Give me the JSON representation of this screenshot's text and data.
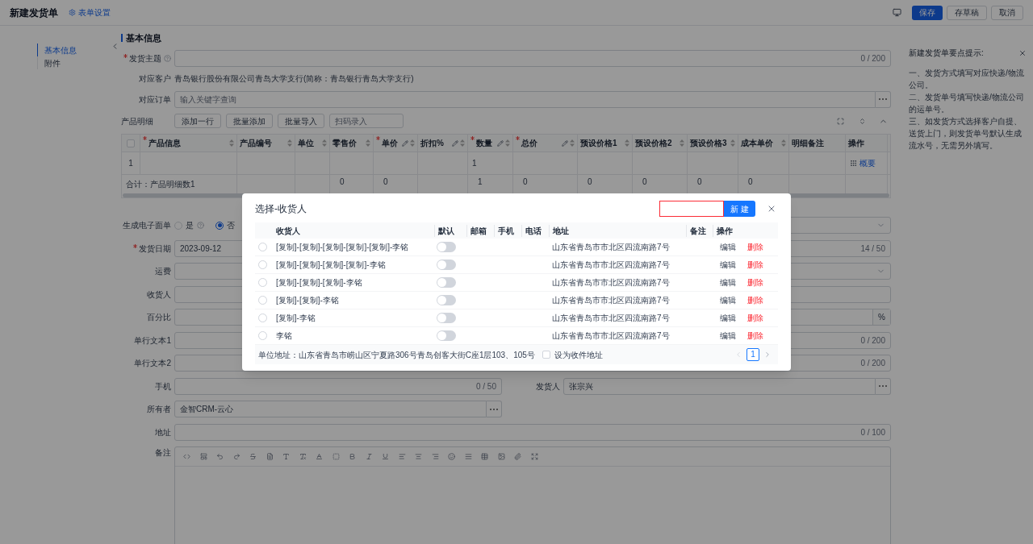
{
  "header": {
    "title": "新建发货单",
    "settings_link": "表单设置",
    "buttons": [
      {
        "label": "保存",
        "kind": "primary"
      },
      {
        "label": "存草稿",
        "kind": "default"
      },
      {
        "label": "取消",
        "kind": "default"
      }
    ]
  },
  "nav": {
    "items": [
      {
        "label": "基本信息",
        "selected": true
      },
      {
        "label": "附件",
        "selected": false
      }
    ]
  },
  "section_title": "基本信息",
  "form_top": [
    {
      "fields": [
        {
          "label": "发货主题",
          "required": true,
          "help": true,
          "kind": "input",
          "counter": "0 / 200"
        }
      ]
    },
    {
      "fields": [
        {
          "label": "对应客户",
          "kind": "text",
          "value": "青岛银行股份有限公司青岛大学支行(简称：青岛银行青岛大学支行)"
        }
      ]
    },
    {
      "fields": [
        {
          "label": "对应订单",
          "kind": "lookup",
          "placeholder": "输入关键字查询"
        }
      ]
    }
  ],
  "products": {
    "label": "产品明细",
    "buttons": [
      "添加一行",
      "批量添加",
      "批量导入"
    ],
    "scan_placeholder": "扫码录入",
    "columns": [
      {
        "kind": "check",
        "checked": false
      },
      {
        "label": "产品信息",
        "required": true,
        "sortable": true
      },
      {
        "label": "产品编号",
        "sortable": true
      },
      {
        "label": "单位",
        "sortable": true
      },
      {
        "label": "零售价",
        "sortable": true,
        "total": "0"
      },
      {
        "label": "单价",
        "required": true,
        "editable": true,
        "sortable": true,
        "total": "0"
      },
      {
        "label": "折扣%",
        "editable": true,
        "sortable": true
      },
      {
        "label": "数量",
        "required": true,
        "editable": true,
        "sortable": true,
        "total": "1"
      },
      {
        "label": "总价",
        "required": true,
        "editable": true,
        "sortable": true,
        "total": "0"
      },
      {
        "label": "预设价格1",
        "sortable": true,
        "total": "0"
      },
      {
        "label": "预设价格2",
        "sortable": true,
        "total": "0"
      },
      {
        "label": "预设价格3",
        "sortable": true,
        "total": "0"
      },
      {
        "label": "成本单价",
        "sortable": true,
        "total": "0"
      },
      {
        "label": "明细备注"
      },
      {
        "label": "操作"
      }
    ],
    "rows": [
      {
        "index": "1",
        "quantity": "1",
        "action": "概要"
      }
    ],
    "total_label": "合计：产品明细数1"
  },
  "form_bottom": [
    {
      "fields": [
        {
          "label": "生成电子面单",
          "kind": "radio",
          "options": [
            {
              "label": "是",
              "selected": false,
              "help": true
            },
            {
              "label": "否",
              "selected": true
            }
          ]
        },
        {
          "kind": "select"
        }
      ]
    },
    {
      "fields": [
        {
          "label": "发货日期",
          "required": true,
          "kind": "input",
          "value": "2023-09-12",
          "counter": "14 / 50"
        }
      ]
    },
    {
      "fields": [
        {
          "label": "运费",
          "kind": "select"
        }
      ]
    },
    {
      "fields": [
        {
          "label": "收货人",
          "kind": "input"
        }
      ]
    },
    {
      "fields": [
        {
          "label": "百分比",
          "kind": "input",
          "suffix": "%"
        }
      ]
    },
    {
      "fields": [
        {
          "label": "单行文本1",
          "kind": "input",
          "counter": "0 / 200"
        }
      ]
    },
    {
      "fields": [
        {
          "label": "单行文本2",
          "kind": "input",
          "counter": "0 / 200"
        }
      ]
    },
    {
      "fields": [
        {
          "label": "手机",
          "kind": "input",
          "counter": "0 / 50"
        },
        {
          "label": "发货人",
          "kind": "lookup",
          "value": "张宗兴"
        }
      ]
    },
    {
      "fields": [
        {
          "label": "所有者",
          "kind": "lookup",
          "value": "金智CRM-云心"
        },
        {
          "kind": "empty"
        }
      ]
    },
    {
      "fields": [
        {
          "label": "地址",
          "kind": "input",
          "counter": "0 / 100"
        }
      ]
    },
    {
      "fields": [
        {
          "label": "备注",
          "kind": "editor"
        }
      ]
    }
  ],
  "tips": {
    "title": "新建发货单要点提示:",
    "lines": [
      "一、发货方式填写对应快递/物流公司。",
      "二、发货单号填写快递/物流公司的运单号。",
      "三、如发货方式选择客户自提、送货上门，则发货单号默认生成流水号，无需另外填写。"
    ]
  },
  "dialog": {
    "title": "选择-收货人",
    "search": {
      "invalid": true
    },
    "new_button": "新 建",
    "columns": [
      "收货人",
      "默认",
      "邮箱",
      "手机",
      "电话",
      "地址",
      "备注",
      "操作"
    ],
    "rows": [
      {
        "selected": false,
        "name": "[复制]-[复制]-[复制]-[复制]-[复制]-李铭",
        "default": false,
        "address": "山东省青岛市市北区四流南路7号",
        "edit": "编辑",
        "delete": "删除"
      },
      {
        "selected": false,
        "name": "[复制]-[复制]-[复制]-[复制]-李铭",
        "default": false,
        "address": "山东省青岛市市北区四流南路7号",
        "edit": "编辑",
        "delete": "删除"
      },
      {
        "selected": false,
        "name": "[复制]-[复制]-[复制]-李铭",
        "default": false,
        "address": "山东省青岛市市北区四流南路7号",
        "edit": "编辑",
        "delete": "删除"
      },
      {
        "selected": false,
        "name": "[复制]-[复制]-李铭",
        "default": false,
        "address": "山东省青岛市市北区四流南路7号",
        "edit": "编辑",
        "delete": "删除"
      },
      {
        "selected": false,
        "name": "[复制]-李铭",
        "default": false,
        "address": "山东省青岛市市北区四流南路7号",
        "edit": "编辑",
        "delete": "删除"
      },
      {
        "selected": false,
        "name": "李铭",
        "default": false,
        "address": "山东省青岛市市北区四流南路7号",
        "edit": "编辑",
        "delete": "删除"
      }
    ],
    "footer": {
      "address": "单位地址：山东省青岛市崂山区宁夏路306号青岛创客大街C座1层103、105号",
      "set_checkbox": {
        "label": "设为收件地址",
        "checked": false
      }
    },
    "pages": [
      {
        "label": "1",
        "selected": true
      }
    ]
  }
}
